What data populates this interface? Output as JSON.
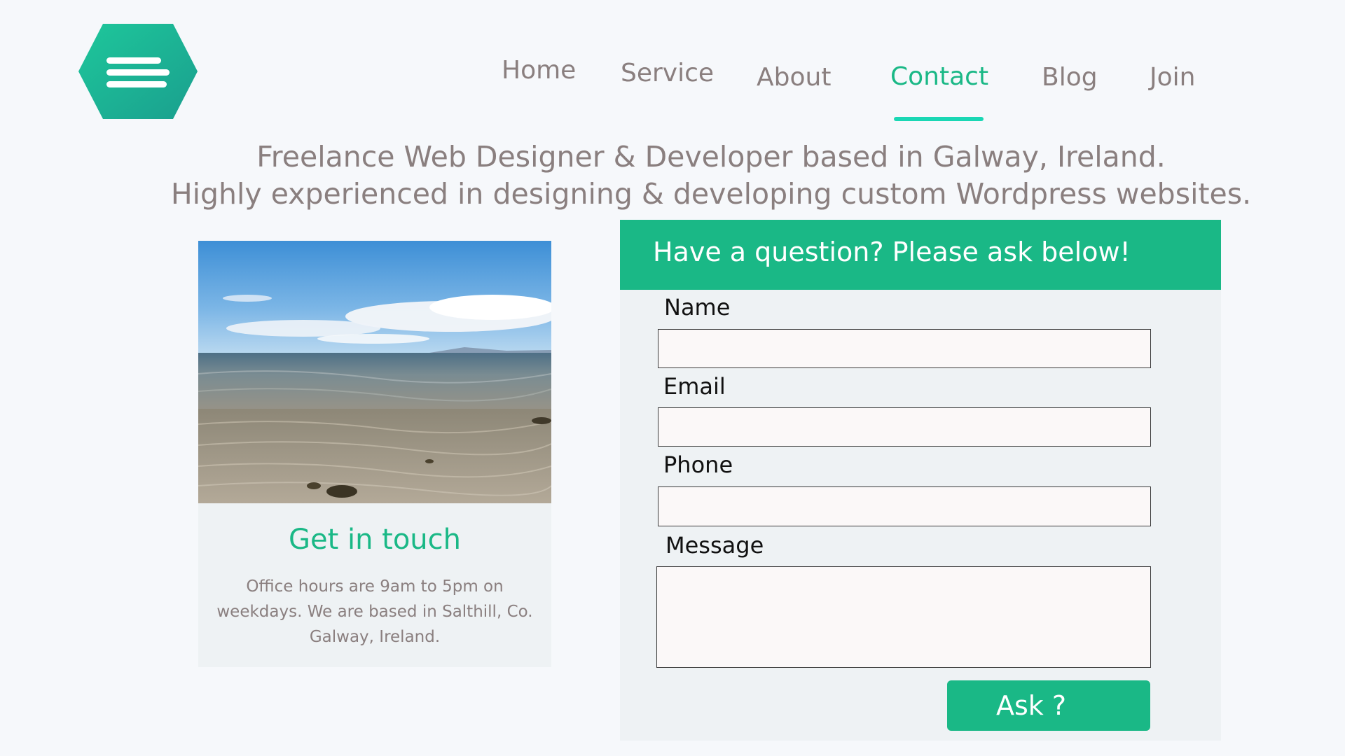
{
  "nav": {
    "menu_icon": "hamburger-hexagon-icon",
    "links": [
      {
        "label": "Home",
        "active": false
      },
      {
        "label": "Service",
        "active": false
      },
      {
        "label": "About",
        "active": false
      },
      {
        "label": "Contact",
        "active": true
      },
      {
        "label": "Blog",
        "active": false
      },
      {
        "label": "Join",
        "active": false
      }
    ]
  },
  "tagline": {
    "line1": "Freelance Web Designer & Developer based in Galway, Ireland.",
    "line2": "Highly experienced in designing & developing custom Wordpress websites."
  },
  "contact_card": {
    "image": "beach-shore-photo",
    "title": "Get in touch",
    "text": "Office hours are 9am to 5pm on weekdays. We are based in Salthill, Co. Galway, Ireland."
  },
  "form": {
    "header": "Have a question? Please ask below!",
    "name_label": "Name",
    "name_value": "",
    "email_label": "Email",
    "email_value": "",
    "phone_label": "Phone",
    "phone_value": "",
    "message_label": "Message",
    "message_value": "",
    "submit_label": "Ask ?"
  },
  "colors": {
    "accent": "#1ab886",
    "underline": "#1ad7b4",
    "text_muted": "#8a7f7f",
    "background": "#f6f8fb",
    "panel": "#eef2f4"
  }
}
